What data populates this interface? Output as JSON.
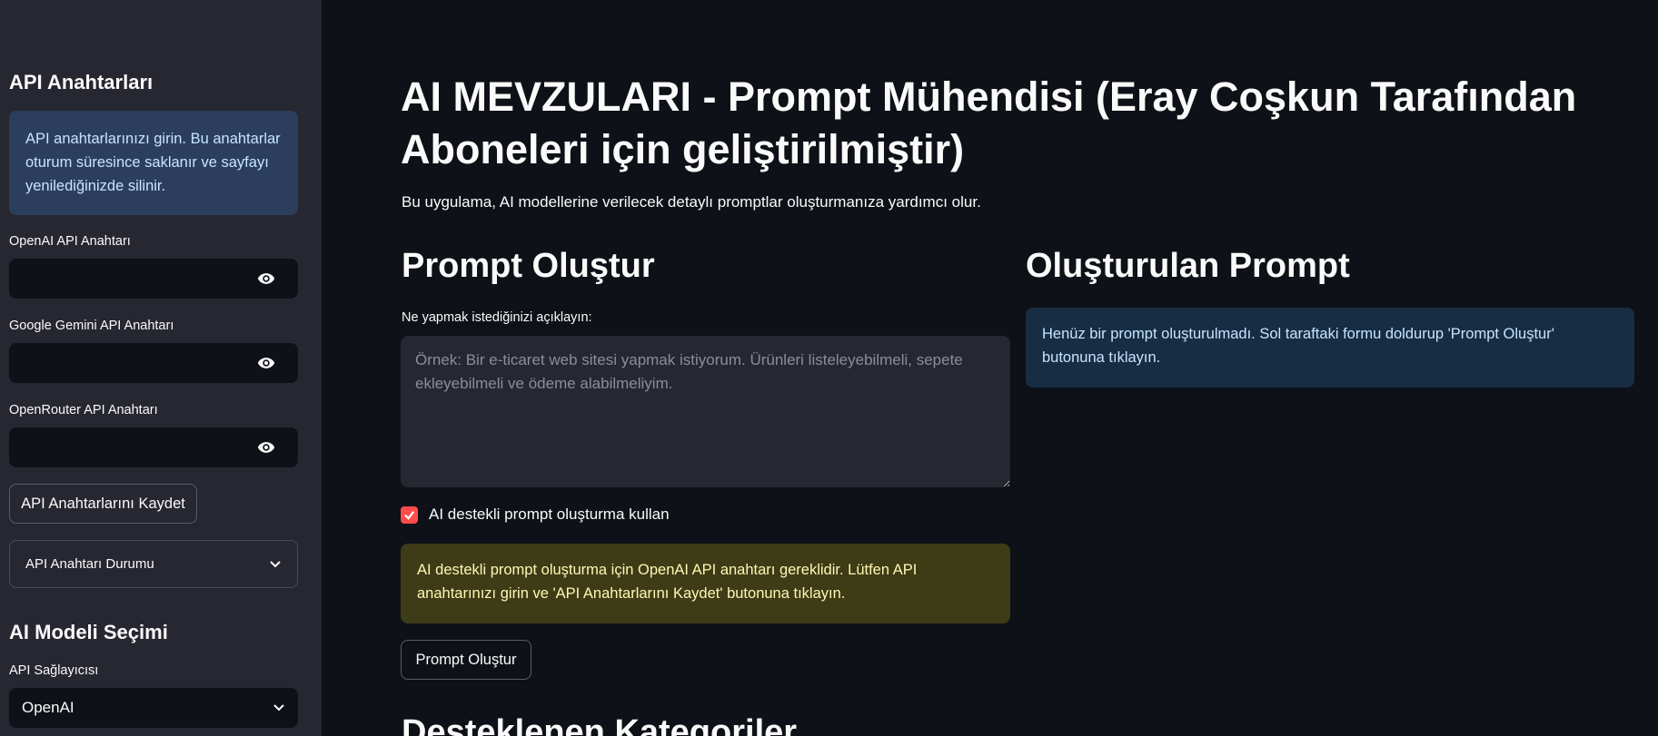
{
  "sidebar": {
    "api_keys_heading": "API Anahtarları",
    "api_keys_info": "API anahtarlarınızı girin. Bu anahtarlar oturum süresince saklanır ve sayfayı yenilediğinizde silinir.",
    "openai_label": "OpenAI API Anahtarı",
    "gemini_label": "Google Gemini API Anahtarı",
    "openrouter_label": "OpenRouter API Anahtarı",
    "save_button": "API Anahtarlarını Kaydet",
    "status_expander": "API Anahtarı Durumu",
    "model_heading": "AI Modeli Seçimi",
    "provider_label": "API Sağlayıcısı",
    "provider_value": "OpenAI"
  },
  "main": {
    "title": "AI MEVZULARI - Prompt Mühendisi (Eray Coşkun Tarafından Aboneleri için geliştirilmiştir)",
    "subtitle": "Bu uygulama, AI modellerine verilecek detaylı promptlar oluşturmanıza yardımcı olur.",
    "create_heading": "Prompt Oluştur",
    "describe_label": "Ne yapmak istediğinizi açıklayın:",
    "describe_placeholder": "Örnek: Bir e-ticaret web sitesi yapmak istiyorum. Ürünleri listeleyebilmeli, sepete ekleyebilmeli ve ödeme alabilmeliyim.",
    "ai_checkbox_label": "AI destekli prompt oluşturma kullan",
    "ai_checkbox_checked": true,
    "warning": "AI destekli prompt oluşturma için OpenAI API anahtarı gereklidir. Lütfen API anahtarınızı girin ve 'API Anahtarlarını Kaydet' butonuna tıklayın.",
    "create_button": "Prompt Oluştur",
    "categories_heading": "Desteklenen Kategoriler",
    "result_heading": "Oluşturulan Prompt",
    "result_info": "Henüz bir prompt oluşturulmadı. Sol taraftaki formu doldurup 'Prompt Oluştur' butonuna tıklayın."
  },
  "colors": {
    "accent": "#ff4b4b",
    "background": "#0e1117",
    "sidebar": "#262730"
  }
}
